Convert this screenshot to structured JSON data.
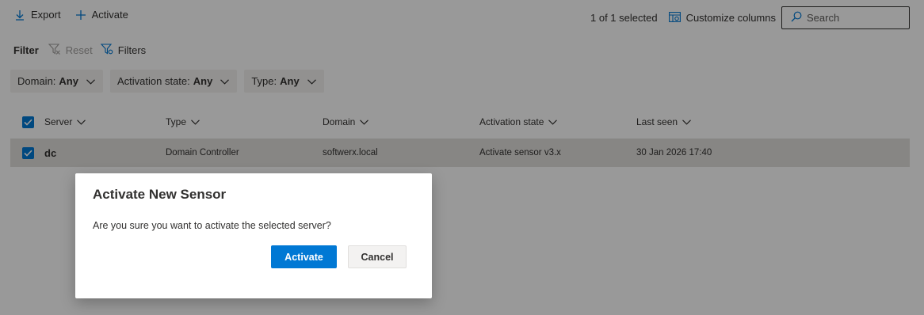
{
  "toolbar": {
    "export_label": "Export",
    "activate_label": "Activate",
    "selection_count": "1 of 1 selected",
    "customize_label": "Customize columns",
    "search_placeholder": "Search"
  },
  "filter": {
    "label": "Filter",
    "reset_label": "Reset",
    "filters_label": "Filters",
    "chips": [
      {
        "name": "Domain:",
        "value": "Any"
      },
      {
        "name": "Activation state:",
        "value": "Any"
      },
      {
        "name": "Type:",
        "value": "Any"
      }
    ]
  },
  "table": {
    "columns": [
      "Server",
      "Type",
      "Domain",
      "Activation state",
      "Last seen"
    ],
    "rows": [
      {
        "server": "dc",
        "type": "Domain Controller",
        "domain": "softwerx.local",
        "activation_state": "Activate sensor v3.x",
        "last_seen": "30 Jan 2026 17:40"
      }
    ]
  },
  "dialog": {
    "title": "Activate New Sensor",
    "message": "Are you sure you want to activate the selected server?",
    "confirm_label": "Activate",
    "cancel_label": "Cancel"
  },
  "colors": {
    "accent": "#0078d4",
    "overlay": "rgba(0,0,0,0.40)",
    "selected_row": "#e1dfdd"
  }
}
